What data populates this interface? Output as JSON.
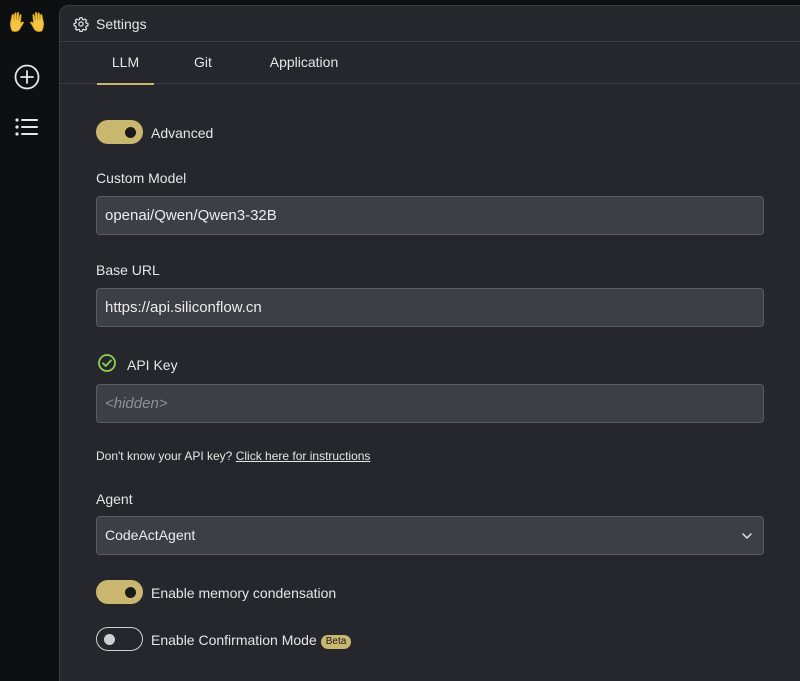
{
  "rail": {
    "logo_icon": "raised-hands-icon",
    "new_icon": "plus-circle-icon",
    "list_icon": "list-icon"
  },
  "header": {
    "title": "Settings",
    "icon": "gear-icon"
  },
  "tabs": [
    {
      "label": "LLM",
      "active": true
    },
    {
      "label": "Git",
      "active": false
    },
    {
      "label": "Application",
      "active": false
    }
  ],
  "advanced": {
    "label": "Advanced",
    "on": true
  },
  "custom_model": {
    "label": "Custom Model",
    "value": "openai/Qwen/Qwen3-32B"
  },
  "base_url": {
    "label": "Base URL",
    "value": "https://api.siliconflow.cn"
  },
  "api_key": {
    "label": "API Key",
    "placeholder": "<hidden>",
    "status_icon": "check-circle-icon"
  },
  "help": {
    "text": "Don't know your API key?",
    "link": "Click here for instructions"
  },
  "agent": {
    "label": "Agent",
    "value": "CodeActAgent"
  },
  "memory": {
    "label": "Enable memory condensation",
    "on": true
  },
  "confirmation": {
    "label": "Enable Confirmation Mode",
    "on": false,
    "badge": "Beta"
  },
  "colors": {
    "accent": "#c9b770",
    "panel": "#25272d",
    "input": "#3c3f45",
    "check": "#8fd14f"
  }
}
